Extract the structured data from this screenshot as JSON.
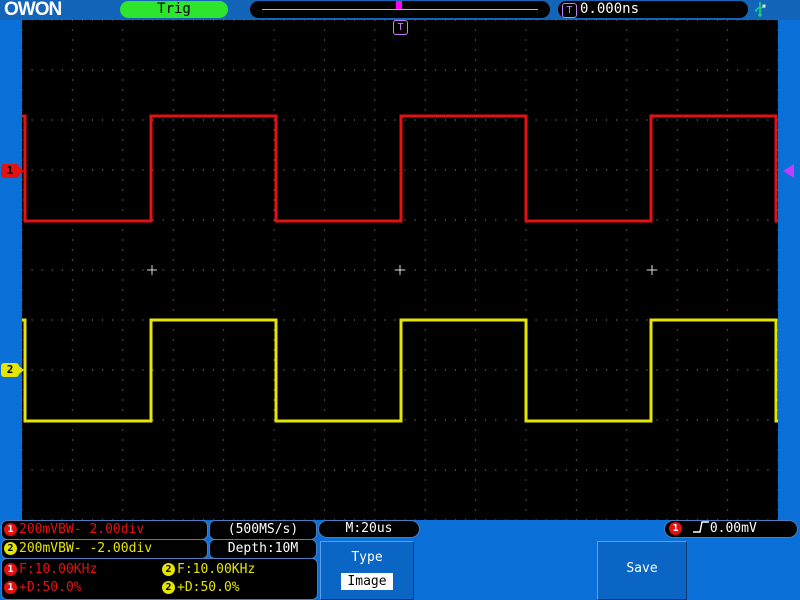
{
  "header": {
    "logo_text": "OWON",
    "trigger_status": "Trig",
    "trigger_time_badge": "T",
    "trigger_time": "0.000ns",
    "usb_icon": "usb-icon"
  },
  "markers": {
    "ch1": "1",
    "ch2": "2",
    "trigger_position": "T"
  },
  "channels": {
    "ch1": {
      "badge": "1",
      "setting": "200mVBW- 2.00div",
      "color": "#e51010"
    },
    "ch2": {
      "badge": "2",
      "setting": "200mVBW- -2.00div",
      "color": "#e5e500"
    }
  },
  "acquisition": {
    "sample_rate": "(500MS/s)",
    "depth": "Depth:10M",
    "timebase": "M:20us"
  },
  "trigger": {
    "badge": "1",
    "edge_icon": "rising-edge-icon",
    "level": "0.00mV"
  },
  "measurements": {
    "ch1_frequency": "F:10.00KHz",
    "ch2_frequency": "F:10.00KHz",
    "ch1_duty": "+D:50.0%",
    "ch2_duty": "+D:50.0%"
  },
  "menu": {
    "type_label": "Type",
    "type_value": "Image",
    "save_label": "Save"
  },
  "colors": {
    "background": "#0a6fd6",
    "trigger_status_bg": "#2ee52e",
    "trigger_marker": "#c03cff",
    "ch1": "#e51010",
    "ch2": "#e5e500"
  },
  "chart_data": {
    "type": "line",
    "signal": "square wave",
    "grid": {
      "divisions_x": 15,
      "divisions_y": 10,
      "on": true
    },
    "series": [
      {
        "name": "CH1",
        "frequency": "10.00KHz",
        "duty": "50.0%"
      },
      {
        "name": "CH2",
        "frequency": "10.00KHz",
        "duty": "50.0%"
      }
    ]
  }
}
